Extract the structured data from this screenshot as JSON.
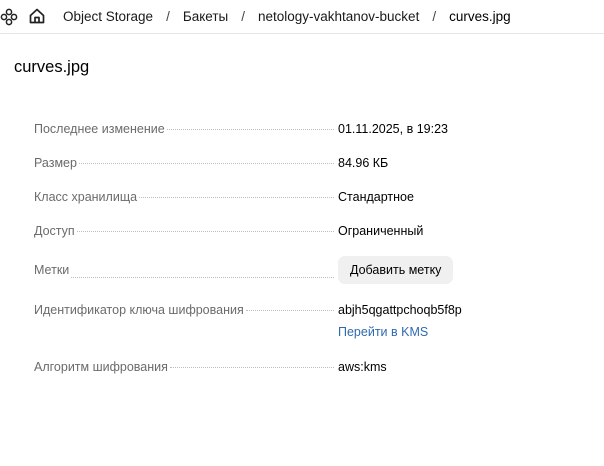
{
  "breadcrumb": {
    "items": [
      {
        "label": "Object Storage"
      },
      {
        "label": "Бакеты"
      },
      {
        "label": "netology-vakhtanov-bucket"
      },
      {
        "label": "curves.jpg"
      }
    ],
    "separator": "/"
  },
  "page": {
    "title": "curves.jpg"
  },
  "properties": {
    "last_modified": {
      "label": "Последнее изменение",
      "value": "01.11.2025, в 19:23"
    },
    "size": {
      "label": "Размер",
      "value": "84.96 КБ"
    },
    "storage_class": {
      "label": "Класс хранилища",
      "value": "Стандартное"
    },
    "access": {
      "label": "Доступ",
      "value": "Ограниченный"
    },
    "tags": {
      "label": "Метки",
      "button_label": "Добавить метку"
    },
    "encryption_key": {
      "label": "Идентификатор ключа шифрования",
      "value": "abjh5qgattpchoqb5f8p",
      "link_label": "Перейти в KMS"
    },
    "encryption_algorithm": {
      "label": "Алгоритм шифрования",
      "value": "aws:kms"
    }
  },
  "icons": {
    "services": "services-icon",
    "home": "home-icon"
  },
  "colors": {
    "link": "#2f6ab1",
    "label": "#6b6b6b",
    "button_bg": "#f0f0f0"
  }
}
